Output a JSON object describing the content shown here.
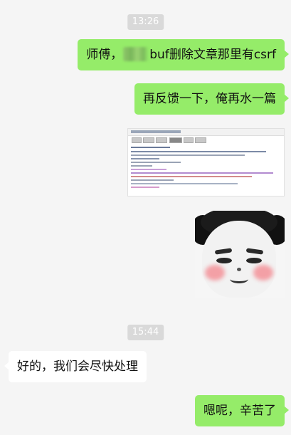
{
  "messages": [
    {
      "kind": "time",
      "text": "13:26"
    },
    {
      "kind": "sent",
      "prefix": "师傅，",
      "suffix": "buf删除文章那里有csrf"
    },
    {
      "kind": "sent",
      "text": "再反馈一下，俺再水一篇"
    },
    {
      "kind": "sent-image",
      "image": "screenshot-thumbnail"
    },
    {
      "kind": "sent-image",
      "image": "panda-face-sticker"
    },
    {
      "kind": "time",
      "text": "15:44"
    },
    {
      "kind": "received",
      "text": "好的，我们会尽快处理"
    },
    {
      "kind": "sent",
      "text": "嗯呢，辛苦了"
    }
  ],
  "colors": {
    "sent_bubble": "#95ec69",
    "received_bubble": "#ffffff",
    "background": "#f5f5f5",
    "timestamp_bg": "#d9d9d9"
  }
}
